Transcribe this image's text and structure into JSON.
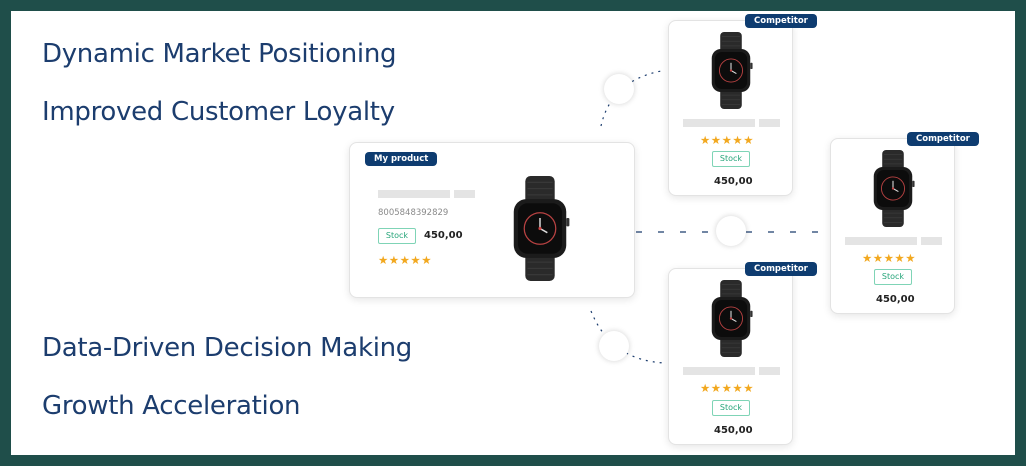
{
  "headlines": {
    "h1": "Dynamic Market Positioning",
    "h2": "Improved Customer Loyalty",
    "h3": "Data-Driven Decision Making",
    "h4": "Growth Acceleration"
  },
  "my_product": {
    "badge": "My product",
    "sku": "8005848392829",
    "stock_label": "Stock",
    "price": "450,00",
    "stars": "★★★★★"
  },
  "competitors": [
    {
      "badge": "Competitor",
      "stock_label": "Stock",
      "price": "450,00",
      "stars": "★★★★★"
    },
    {
      "badge": "Competitor",
      "stock_label": "Stock",
      "price": "450,00",
      "stars": "★★★★★"
    },
    {
      "badge": "Competitor",
      "stock_label": "Stock",
      "price": "450,00",
      "stars": "★★★★★"
    }
  ],
  "colors": {
    "frame": "#1f4e4a",
    "headline": "#1c3d6e",
    "badge": "#0e3c70",
    "star": "#f2a81f",
    "stock": "#27a57a"
  },
  "icons": {
    "product_image": "smartwatch-icon",
    "rating": "star-icon"
  }
}
